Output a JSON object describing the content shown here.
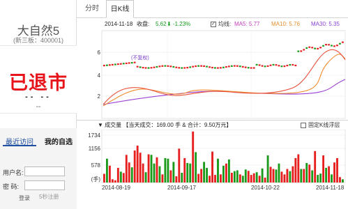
{
  "stock": {
    "name": "大自然5",
    "code": "(新三板：400001)",
    "status": "已退市",
    "dash1": "-- --",
    "dash2": "--"
  },
  "sidebar": {
    "tabs": [
      "最近访问",
      "我的自选"
    ],
    "login": {
      "user_label": "用户名:",
      "pwd_label": "密  码:",
      "login_btn": "登录",
      "register": "5秒注册"
    }
  },
  "chart_tabs": [
    "分时",
    "日K线"
  ],
  "quote": {
    "date": "2014-11-18",
    "close_label": "收盘:",
    "close": "5.62",
    "change": "⬇ -1.23%",
    "checkbox": "✓",
    "avg_label": "均线:",
    "ma5": "MA5: 5.77",
    "ma10": "MA10: 5.76",
    "ma30": "MA30: 5.35"
  },
  "kchart_labels": {
    "price_ticks": [
      "6",
      "4",
      "2"
    ],
    "unadjusted": "(不复权)"
  },
  "volume_bar": {
    "label": "▼ 成交量 【当天成交：169.00 手 & 合计：9.50万元】",
    "fixed_label": "固定K线浮层"
  },
  "chart_data": {
    "type": "bar",
    "title": "",
    "x_ticks": [
      "2014-08-19",
      "2014-09-17",
      "2014-10-22",
      "2014-11-18"
    ],
    "y_ticks": [
      "1734",
      "1156",
      "578",
      "(手)"
    ],
    "ylim": [
      0,
      1900
    ],
    "bar_colors": {
      "up": "#e61e1e",
      "down": "#1a9a1a"
    },
    "values": [
      320,
      880,
      620,
      120,
      80,
      540,
      400,
      350,
      1020,
      740,
      560,
      1180,
      1360,
      1100,
      700,
      380,
      1040,
      1020,
      700,
      930,
      600,
      300,
      900,
      880,
      450,
      760,
      230,
      1250,
      360,
      900,
      720,
      700,
      1880,
      1120,
      320,
      500,
      760,
      540,
      250,
      1140,
      280,
      880,
      300,
      620,
      700,
      850,
      360,
      420,
      450,
      300,
      250,
      480,
      430,
      280,
      340,
      380,
      250,
      520,
      180,
      1000,
      580,
      500,
      480,
      700,
      400,
      300,
      500,
      420,
      600,
      900,
      1040,
      500,
      500,
      720,
      660,
      450,
      1160,
      280,
      330,
      1000,
      540,
      600,
      300,
      740,
      900,
      200,
      120
    ],
    "up": [
      1,
      0,
      1,
      1,
      1,
      1,
      0,
      1,
      1,
      1,
      0,
      1,
      1,
      1,
      1,
      0,
      1,
      0,
      0,
      1,
      0,
      1,
      0,
      0,
      1,
      0,
      1,
      1,
      0,
      1,
      0,
      0,
      1,
      0,
      1,
      1,
      0,
      0,
      1,
      1,
      1,
      0,
      1,
      0,
      1,
      0,
      1,
      0,
      0,
      1,
      0,
      0,
      1,
      1,
      1,
      0,
      1,
      0,
      1,
      0,
      1,
      1,
      0,
      0,
      1,
      1,
      1,
      0,
      1,
      1,
      1,
      0,
      1,
      0,
      1,
      0,
      1,
      0,
      0,
      1,
      0,
      1,
      0,
      1,
      1,
      1,
      0
    ]
  }
}
